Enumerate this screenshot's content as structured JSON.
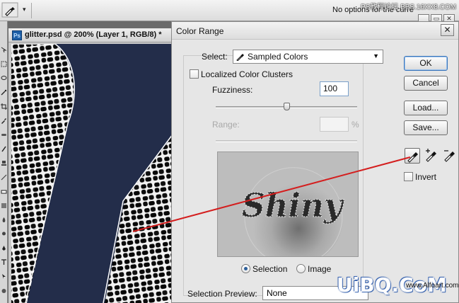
{
  "options_bar": {
    "status_text": "No options for the curre",
    "watermark_text": "PS教程论坛 BBS.16XX8.COM",
    "minimize_glyph": "_",
    "restore_glyph": "▭",
    "close_glyph": "✕",
    "tool_icon": "eyedropper-icon",
    "menu_arrow": "▾"
  },
  "document": {
    "app_icon_text": "Ps",
    "title": "glitter.psd @ 200% (Layer 1, RGB/8) *"
  },
  "dialog": {
    "title": "Color Range",
    "close_glyph": "✕",
    "select_label": "Select:",
    "select_value": "Sampled Colors",
    "localized_label": "Localized Color Clusters",
    "localized_checked": false,
    "fuzziness_label": "Fuzziness:",
    "fuzziness_value": "100",
    "fuzziness_fraction": 0.5,
    "range_label": "Range:",
    "range_value": "",
    "range_unit": "%",
    "preview_text": "Shiny",
    "selection_label": "Selection",
    "image_label": "Image",
    "selected_view": "Selection",
    "selection_preview_label": "Selection Preview:",
    "selection_preview_value": "None",
    "buttons": {
      "ok": "OK",
      "cancel": "Cancel",
      "load": "Load...",
      "save": "Save..."
    },
    "eyedroppers": [
      "eyedropper-icon",
      "eyedropper-plus-icon",
      "eyedropper-minus-icon"
    ],
    "invert_label": "Invert",
    "invert_checked": false
  },
  "watermark": {
    "main": "UiBQ.CoM",
    "secondary": "www.Alfoart.com"
  },
  "colors": {
    "canvas_bg": "#232d4a",
    "annotation_line": "#d41e1e",
    "accent": "#2d5f9a"
  }
}
